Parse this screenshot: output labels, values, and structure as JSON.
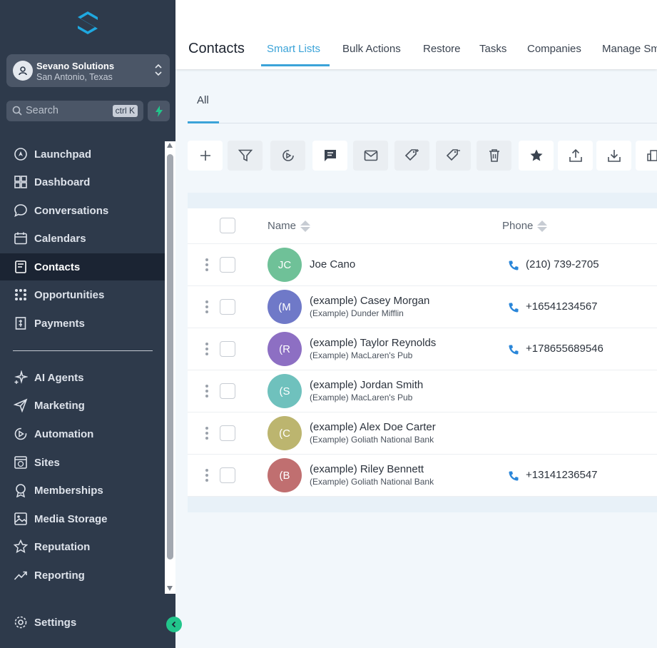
{
  "sidebar": {
    "account": {
      "name": "Sevano Solutions",
      "location": "San Antonio, Texas"
    },
    "search": {
      "placeholder": "Search",
      "shortcut": "ctrl K"
    },
    "items": [
      {
        "label": "Launchpad",
        "icon": "rocket-icon"
      },
      {
        "label": "Dashboard",
        "icon": "grid-icon"
      },
      {
        "label": "Conversations",
        "icon": "chat-icon"
      },
      {
        "label": "Calendars",
        "icon": "calendar-icon"
      },
      {
        "label": "Contacts",
        "icon": "contact-book-icon",
        "active": true
      },
      {
        "label": "Opportunities",
        "icon": "pipeline-icon"
      },
      {
        "label": "Payments",
        "icon": "invoice-icon"
      },
      {
        "label": "AI Agents",
        "icon": "sparkle-icon"
      },
      {
        "label": "Marketing",
        "icon": "send-icon"
      },
      {
        "label": "Automation",
        "icon": "automation-icon"
      },
      {
        "label": "Sites",
        "icon": "globe-icon"
      },
      {
        "label": "Memberships",
        "icon": "badge-icon"
      },
      {
        "label": "Media Storage",
        "icon": "image-icon"
      },
      {
        "label": "Reputation",
        "icon": "star-icon"
      },
      {
        "label": "Reporting",
        "icon": "trend-icon"
      }
    ],
    "settings": "Settings"
  },
  "header": {
    "title": "Contacts",
    "tabs": [
      "Smart Lists",
      "Bulk Actions",
      "Restore",
      "Tasks",
      "Companies",
      "Manage Sm"
    ],
    "active_tab": "Smart Lists",
    "subtab": "All"
  },
  "toolbar": [
    "add-icon",
    "filter-icon",
    "automation-icon",
    "sms-icon",
    "email-icon",
    "add-tag-icon",
    "remove-tag-icon",
    "delete-icon",
    "star-icon",
    "export-icon",
    "import-icon",
    "building-icon"
  ],
  "table": {
    "columns": [
      "Name",
      "Phone"
    ],
    "rows": [
      {
        "initials": "JC",
        "name": "Joe Cano",
        "company": "",
        "phone": "(210) 739-2705",
        "color": "#6fc198"
      },
      {
        "initials": "(M",
        "name": "(example) Casey Morgan",
        "company": "(Example) Dunder Mifflin",
        "phone": "+16541234567",
        "color": "#6f79c8"
      },
      {
        "initials": "(R",
        "name": "(example) Taylor Reynolds",
        "company": "(Example) MacLaren's Pub",
        "phone": "+178655689546",
        "color": "#8d6fc3"
      },
      {
        "initials": "(S",
        "name": "(example) Jordan Smith",
        "company": "(Example) MacLaren's Pub",
        "phone": "",
        "color": "#6fc1bd"
      },
      {
        "initials": "(C",
        "name": "(example) Alex Doe Carter",
        "company": "(Example) Goliath National Bank",
        "phone": "",
        "color": "#bcb56f"
      },
      {
        "initials": "(B",
        "name": "(example) Riley Bennett",
        "company": "(Example) Goliath National Bank",
        "phone": "+13141236547",
        "color": "#c06f70"
      }
    ]
  },
  "colors": {
    "sidebar": "#2e3a4b",
    "accent": "#3ba3d8",
    "active_nav": "#1b2433"
  }
}
